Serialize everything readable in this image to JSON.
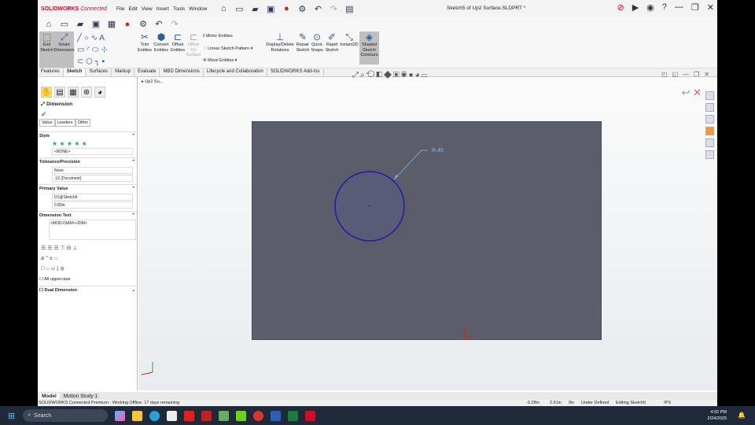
{
  "titlebar": {
    "logo_brand": "SOLIDWORKS",
    "logo_suffix": "Connected",
    "menu": [
      "File",
      "Edit",
      "View",
      "Insert",
      "Tools",
      "Window"
    ],
    "document_title": "Sketch5 of Up2 Surface.SLDPRT *"
  },
  "ribbon": {
    "exit_sketch": "Exit Sketch",
    "smart_dimension": "Smart Dimension",
    "trim": "Trim Entities",
    "convert": "Convert Entities",
    "offset": "Offset Entities",
    "offset_surface": "Offset On Surface",
    "mirror": "Mirror Entities",
    "linear_pattern": "Linear Sketch Pattern",
    "move": "Move Entities",
    "display_delete": "Display/Delete Relations",
    "repair": "Repair Sketch",
    "quick_snaps": "Quick Snaps",
    "rapid_sketch": "Rapid Sketch",
    "instant2d": "Instant2D",
    "shaded": "Shaded Sketch Contours"
  },
  "tabs": [
    "Features",
    "Sketch",
    "Surfaces",
    "Markup",
    "Evaluate",
    "MBD Dimensions",
    "Lifecycle and Collaboration",
    "SOLIDWORKS Add-Ins"
  ],
  "tree": {
    "root": "Up2 Su..."
  },
  "panel": {
    "title": "Dimension",
    "subtabs": [
      "Value",
      "Leaders",
      "Other"
    ],
    "style_label": "Style",
    "style_value": "<NONE>",
    "tolerance_label": "Tolerance/Precision",
    "tolerance_value": "None",
    "precision_value": ".12 (Document)",
    "primary_label": "Primary Value",
    "primary_name": "D1@Sketch5",
    "primary_value": "0.80in",
    "dimtext_label": "Dimension Text",
    "dimtext_value": "<MOD-DIAM><DIM>",
    "all_uppercase": "All uppercase",
    "dual_dimension": "Dual Dimension"
  },
  "sketch": {
    "radius_label": "R.40"
  },
  "bottom_tabs": [
    "Model",
    "Motion Study 1"
  ],
  "status": {
    "left": "SOLIDWORKS Connected Premium - Working Offline: 17 days remaining",
    "x": "-3.28in",
    "y": "2.61in",
    "z": "0in",
    "state": "Under Defined",
    "mode": "Editing Sketch5",
    "units": "IPS"
  },
  "taskbar": {
    "search": "Search",
    "time": "4:02 PM",
    "date": "2/24/2025"
  },
  "colors": {
    "plane": "#5b5d6b",
    "circle_stroke": "#1d1da8",
    "dim": "#7ec3f0",
    "accent": "#c8102e"
  }
}
